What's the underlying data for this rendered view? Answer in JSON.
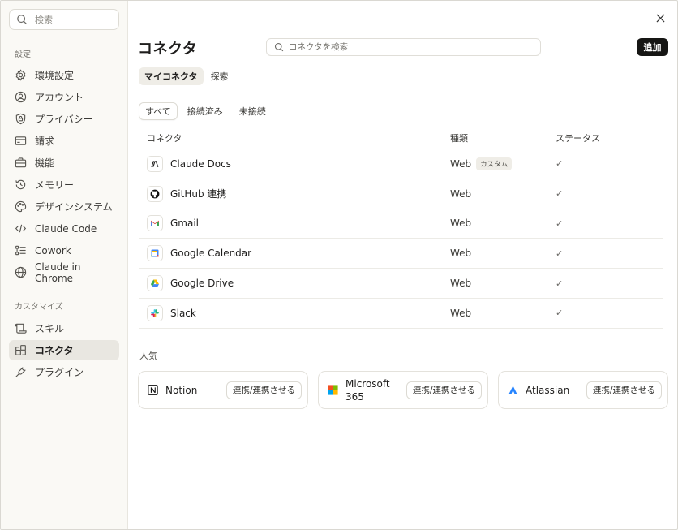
{
  "sidebar": {
    "search_placeholder": "検索",
    "sections": [
      {
        "label": "設定"
      },
      {
        "label": "カスタマイズ"
      }
    ],
    "items": [
      {
        "label": "環境設定",
        "icon": "gear-icon"
      },
      {
        "label": "アカウント",
        "icon": "user-circle-icon"
      },
      {
        "label": "プライバシー",
        "icon": "shield-lock-icon"
      },
      {
        "label": "請求",
        "icon": "credit-card-icon"
      },
      {
        "label": "機能",
        "icon": "briefcase-icon"
      },
      {
        "label": "メモリー",
        "icon": "history-icon"
      },
      {
        "label": "デザインシステム",
        "icon": "palette-icon"
      },
      {
        "label": "Claude Code",
        "icon": "code-icon"
      },
      {
        "label": "Cowork",
        "icon": "checklist-icon"
      },
      {
        "label": "Claude in Chrome",
        "icon": "globe-icon"
      },
      {
        "label": "スキル",
        "icon": "scroll-icon"
      },
      {
        "label": "コネクタ",
        "icon": "blocks-icon",
        "active": true
      },
      {
        "label": "プラグイン",
        "icon": "plug-icon"
      }
    ]
  },
  "main": {
    "title": "コネクタ",
    "search_placeholder": "コネクタを検索",
    "add_label": "追加",
    "tabs": [
      {
        "label": "マイコネクタ",
        "active": true
      },
      {
        "label": "探索"
      }
    ],
    "filters": [
      {
        "label": "すべて",
        "active": true
      },
      {
        "label": "接続済み"
      },
      {
        "label": "未接続"
      }
    ],
    "table": {
      "headers": {
        "name": "コネクタ",
        "type": "種類",
        "status": "ステータス"
      },
      "rows": [
        {
          "name": "Claude Docs",
          "type": "Web",
          "badge": "カスタム",
          "status": "✓",
          "icon": "anthropic-icon"
        },
        {
          "name": "GitHub 連携",
          "type": "Web",
          "status": "✓",
          "icon": "github-icon"
        },
        {
          "name": "Gmail",
          "type": "Web",
          "status": "✓",
          "icon": "gmail-icon"
        },
        {
          "name": "Google Calendar",
          "type": "Web",
          "status": "✓",
          "icon": "google-calendar-icon"
        },
        {
          "name": "Google Drive",
          "type": "Web",
          "status": "✓",
          "icon": "google-drive-icon"
        },
        {
          "name": "Slack",
          "type": "Web",
          "status": "✓",
          "icon": "slack-icon"
        }
      ]
    },
    "popular": {
      "label": "人気",
      "cards": [
        {
          "name": "Notion",
          "button": "連携/連携させる",
          "icon": "notion-icon"
        },
        {
          "name": "Microsoft 365",
          "button": "連携/連携させる",
          "icon": "microsoft-icon"
        },
        {
          "name": "Atlassian",
          "button": "連携/連携させる",
          "icon": "atlassian-icon"
        }
      ]
    }
  },
  "colors": {
    "sidebar_bg": "#faf9f5",
    "active_item_bg": "#e9e7e1",
    "add_button_bg": "#161614",
    "border": "#e4e2dc"
  }
}
